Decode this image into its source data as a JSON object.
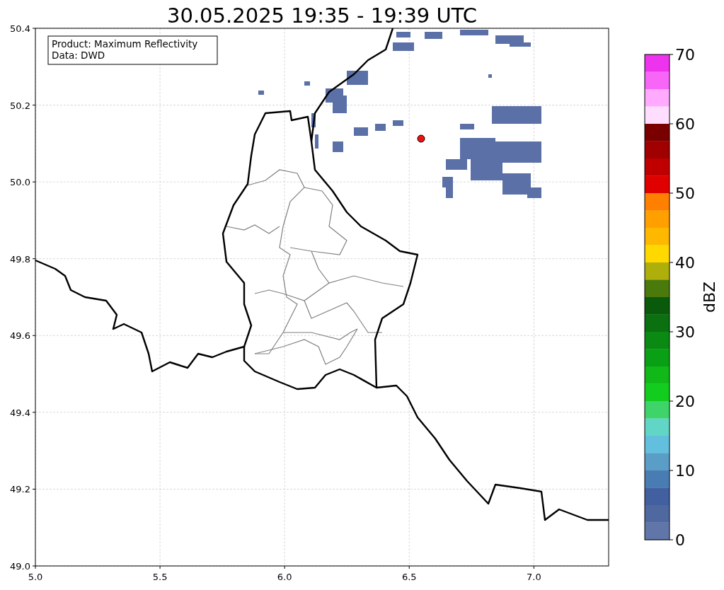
{
  "title": "30.05.2025 19:35 - 19:39 UTC",
  "info_box": [
    "Product: Maximum Reflectivity",
    "Data: DWD"
  ],
  "x_axis": {
    "ticks": [
      "5.0",
      "5.5",
      "6.0",
      "6.5",
      "7.0"
    ]
  },
  "y_axis": {
    "ticks": [
      "50.4",
      "50.2",
      "50.0",
      "49.8",
      "49.6",
      "49.4",
      "49.2",
      "49.0"
    ]
  },
  "colorbar": {
    "label": "dBZ",
    "ticks": [
      "70",
      "60",
      "50",
      "40",
      "30",
      "20",
      "10",
      "0"
    ],
    "segments": [
      {
        "color": "#ee33ee"
      },
      {
        "color": "#f766f7"
      },
      {
        "color": "#ffaaff"
      },
      {
        "color": "#ffddff"
      },
      {
        "color": "#7a0000"
      },
      {
        "color": "#a00000"
      },
      {
        "color": "#c00000"
      },
      {
        "color": "#e00000"
      },
      {
        "color": "#ff7f00"
      },
      {
        "color": "#ff9f00"
      },
      {
        "color": "#ffb800"
      },
      {
        "color": "#ffd800"
      },
      {
        "color": "#aeaf0a"
      },
      {
        "color": "#4a7a0c"
      },
      {
        "color": "#0a5a0c"
      },
      {
        "color": "#0a7010"
      },
      {
        "color": "#0a8a12"
      },
      {
        "color": "#0aa015"
      },
      {
        "color": "#10b818"
      },
      {
        "color": "#12cc1e"
      },
      {
        "color": "#3ed46a"
      },
      {
        "color": "#62d6c6"
      },
      {
        "color": "#62c0de"
      },
      {
        "color": "#5a9ec8"
      },
      {
        "color": "#4a7cb4"
      },
      {
        "color": "#4260a0"
      },
      {
        "color": "#5068a0"
      },
      {
        "color": "#6075a8"
      }
    ]
  }
}
